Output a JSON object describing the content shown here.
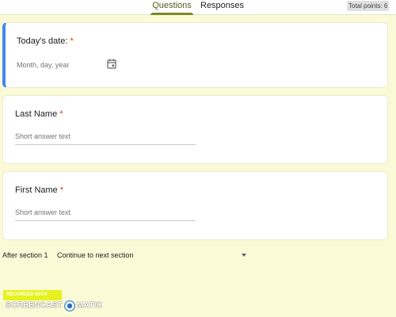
{
  "header": {
    "tabs": [
      {
        "label": "Questions",
        "active": true
      },
      {
        "label": "Responses",
        "active": false
      }
    ],
    "total_points": "Total points: 6"
  },
  "questions": [
    {
      "title": "Today's date:",
      "required_mark": "*",
      "placeholder": "Month, day, year",
      "icon": "calendar-icon"
    },
    {
      "title": "Last Name",
      "required_mark": "*",
      "placeholder": "Short answer text"
    },
    {
      "title": "First Name",
      "required_mark": "*",
      "placeholder": "Short answer text"
    }
  ],
  "section_nav": {
    "label": "After section 1",
    "selected": "Continue to next section"
  },
  "watermark": {
    "top_text": "RECORDED WITH",
    "left_text": "SCREENCAST",
    "right_text": "MATIC"
  },
  "colors": {
    "accent": "#7b8a2c",
    "active_card_border": "#4285f4",
    "required": "#d93025",
    "page_background": "#fafad6"
  }
}
